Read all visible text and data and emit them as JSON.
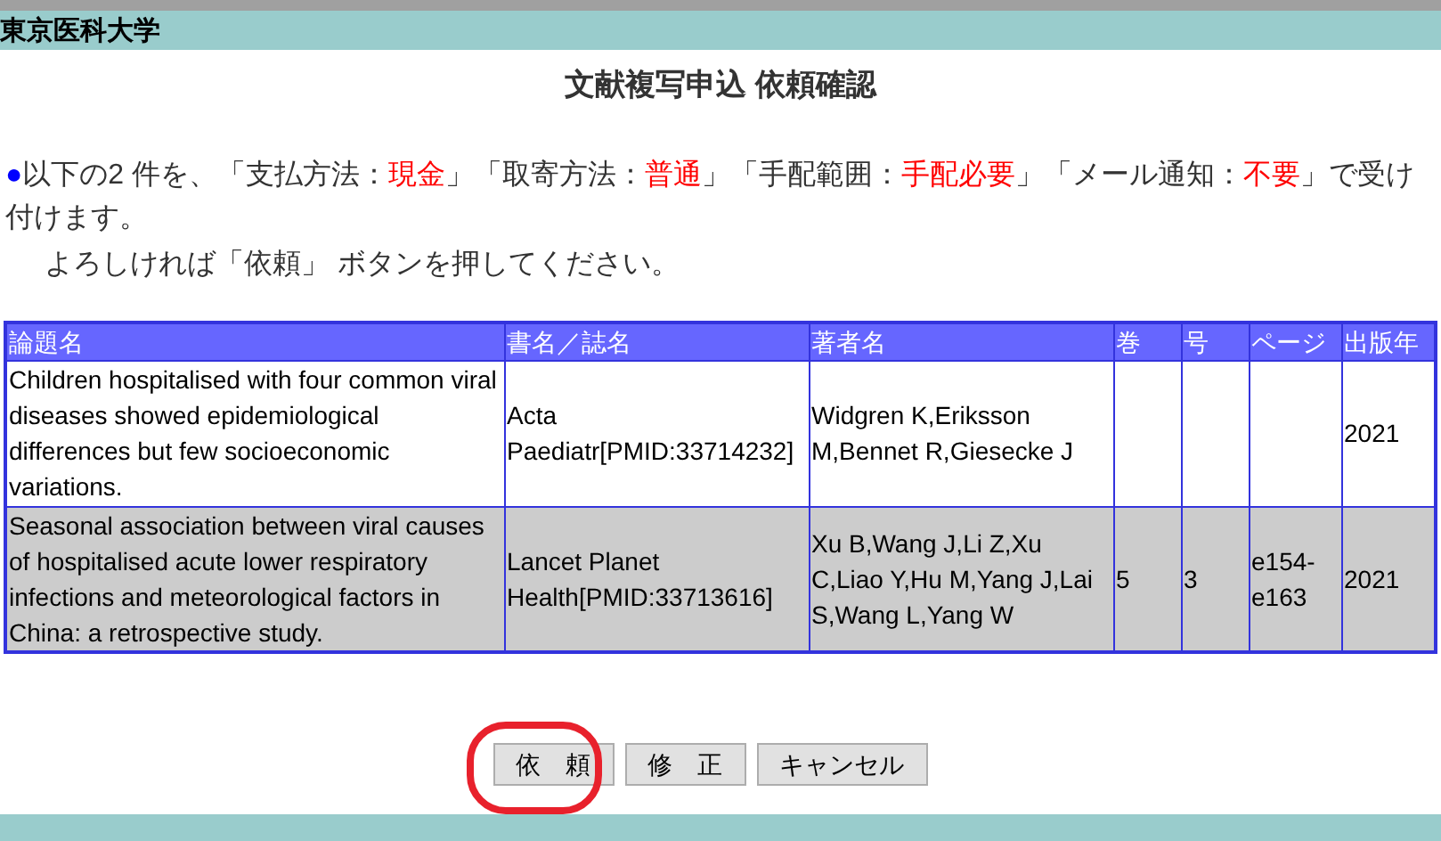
{
  "header": {
    "title": "東京医科大学"
  },
  "page_title": "文献複写申込 依頼確認",
  "message": {
    "bullet": "●",
    "parts": [
      {
        "text": "以下の2 件を、「支払方法：",
        "highlight": false
      },
      {
        "text": "現金",
        "highlight": true
      },
      {
        "text": "」「取寄方法：",
        "highlight": false
      },
      {
        "text": "普通",
        "highlight": true
      },
      {
        "text": "」「手配範囲：",
        "highlight": false
      },
      {
        "text": "手配必要",
        "highlight": true
      },
      {
        "text": "」「メール通知：",
        "highlight": false
      },
      {
        "text": "不要",
        "highlight": true
      },
      {
        "text": "」で受け付けます。",
        "highlight": false
      }
    ],
    "note": "よろしければ「依頼」 ボタンを押してください。"
  },
  "table": {
    "columns": [
      "論題名",
      "書名／誌名",
      "著者名",
      "巻",
      "号",
      "ページ",
      "出版年"
    ],
    "rows": [
      {
        "shaded": false,
        "cells": [
          "Children hospitalised with four common viral diseases showed epidemiological differences but few socioeconomic variations.",
          "Acta Paediatr[PMID:33714232]",
          "Widgren K,Eriksson M,Bennet R,Giesecke J",
          "",
          "",
          "",
          "2021"
        ]
      },
      {
        "shaded": true,
        "cells": [
          "Seasonal association between viral causes of hospitalised acute lower respiratory infections and meteorological factors in China: a retrospective study.",
          "Lancet Planet Health[PMID:33713616]",
          "Xu B,Wang J,Li Z,Xu C,Liao Y,Hu M,Yang J,Lai S,Wang L,Yang W",
          "5",
          "3",
          "e154-e163",
          "2021"
        ]
      }
    ]
  },
  "buttons": [
    {
      "label": "依　頼",
      "circled": true
    },
    {
      "label": "修　正",
      "circled": false
    },
    {
      "label": "キャンセル",
      "circled": false
    }
  ]
}
